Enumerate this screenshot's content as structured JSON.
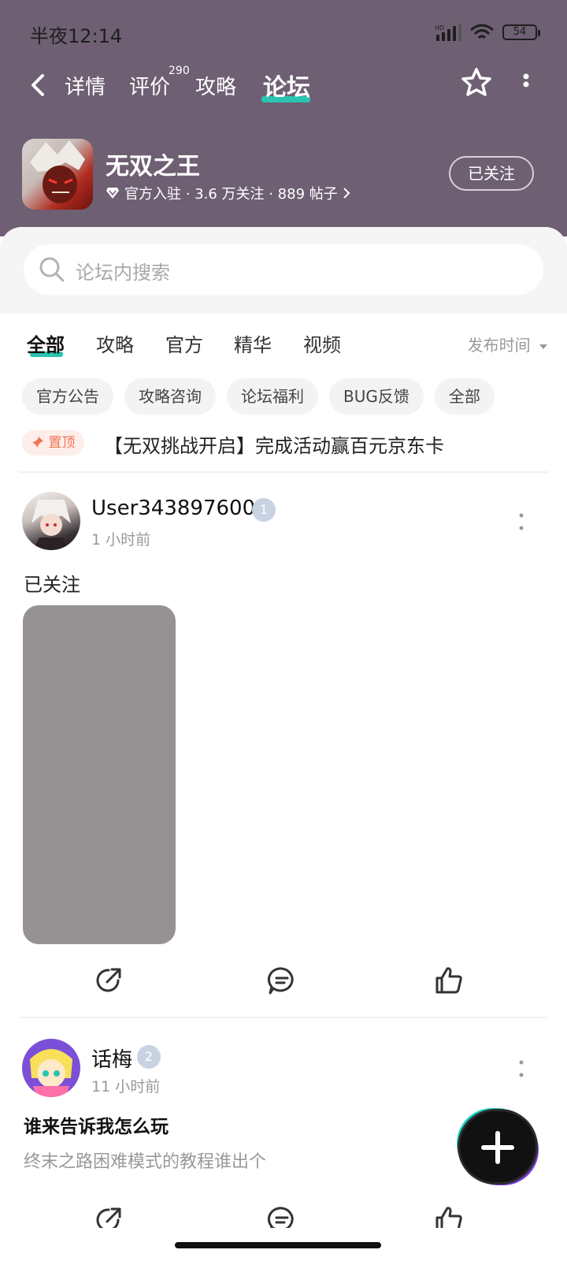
{
  "status_bar": {
    "time": "半夜12:14",
    "battery": "54"
  },
  "nav": {
    "tabs": [
      {
        "label": "详情"
      },
      {
        "label": "评价",
        "badge": "290"
      },
      {
        "label": "攻略"
      },
      {
        "label": "论坛",
        "active": true
      }
    ]
  },
  "game": {
    "title": "无双之王",
    "meta": "官方入驻 · 3.6 万关注 · 889 帖子",
    "follow_label": "已关注"
  },
  "search": {
    "placeholder": "论坛内搜索"
  },
  "tabs": [
    {
      "label": "全部",
      "active": true
    },
    {
      "label": "攻略"
    },
    {
      "label": "官方"
    },
    {
      "label": "精华"
    },
    {
      "label": "视频"
    }
  ],
  "sort_label": "发布时间",
  "chips": [
    "官方公告",
    "攻略咨询",
    "论坛福利",
    "BUG反馈",
    "全部"
  ],
  "pinned": {
    "badge": "置顶",
    "title": "【无双挑战开启】完成活动赢百元京东卡"
  },
  "posts": [
    {
      "user": "User343897600",
      "level": "1",
      "time": "1 小时前",
      "text": "已关注"
    },
    {
      "user": "话梅",
      "level": "2",
      "time": "11 小时前",
      "title": "谁来告诉我怎么玩",
      "subtitle": "终末之路困难模式的教程谁出个"
    }
  ],
  "colors": {
    "header_bg": "#6e5f73",
    "accent": "#2bc4b3",
    "pin": "#f07456"
  }
}
